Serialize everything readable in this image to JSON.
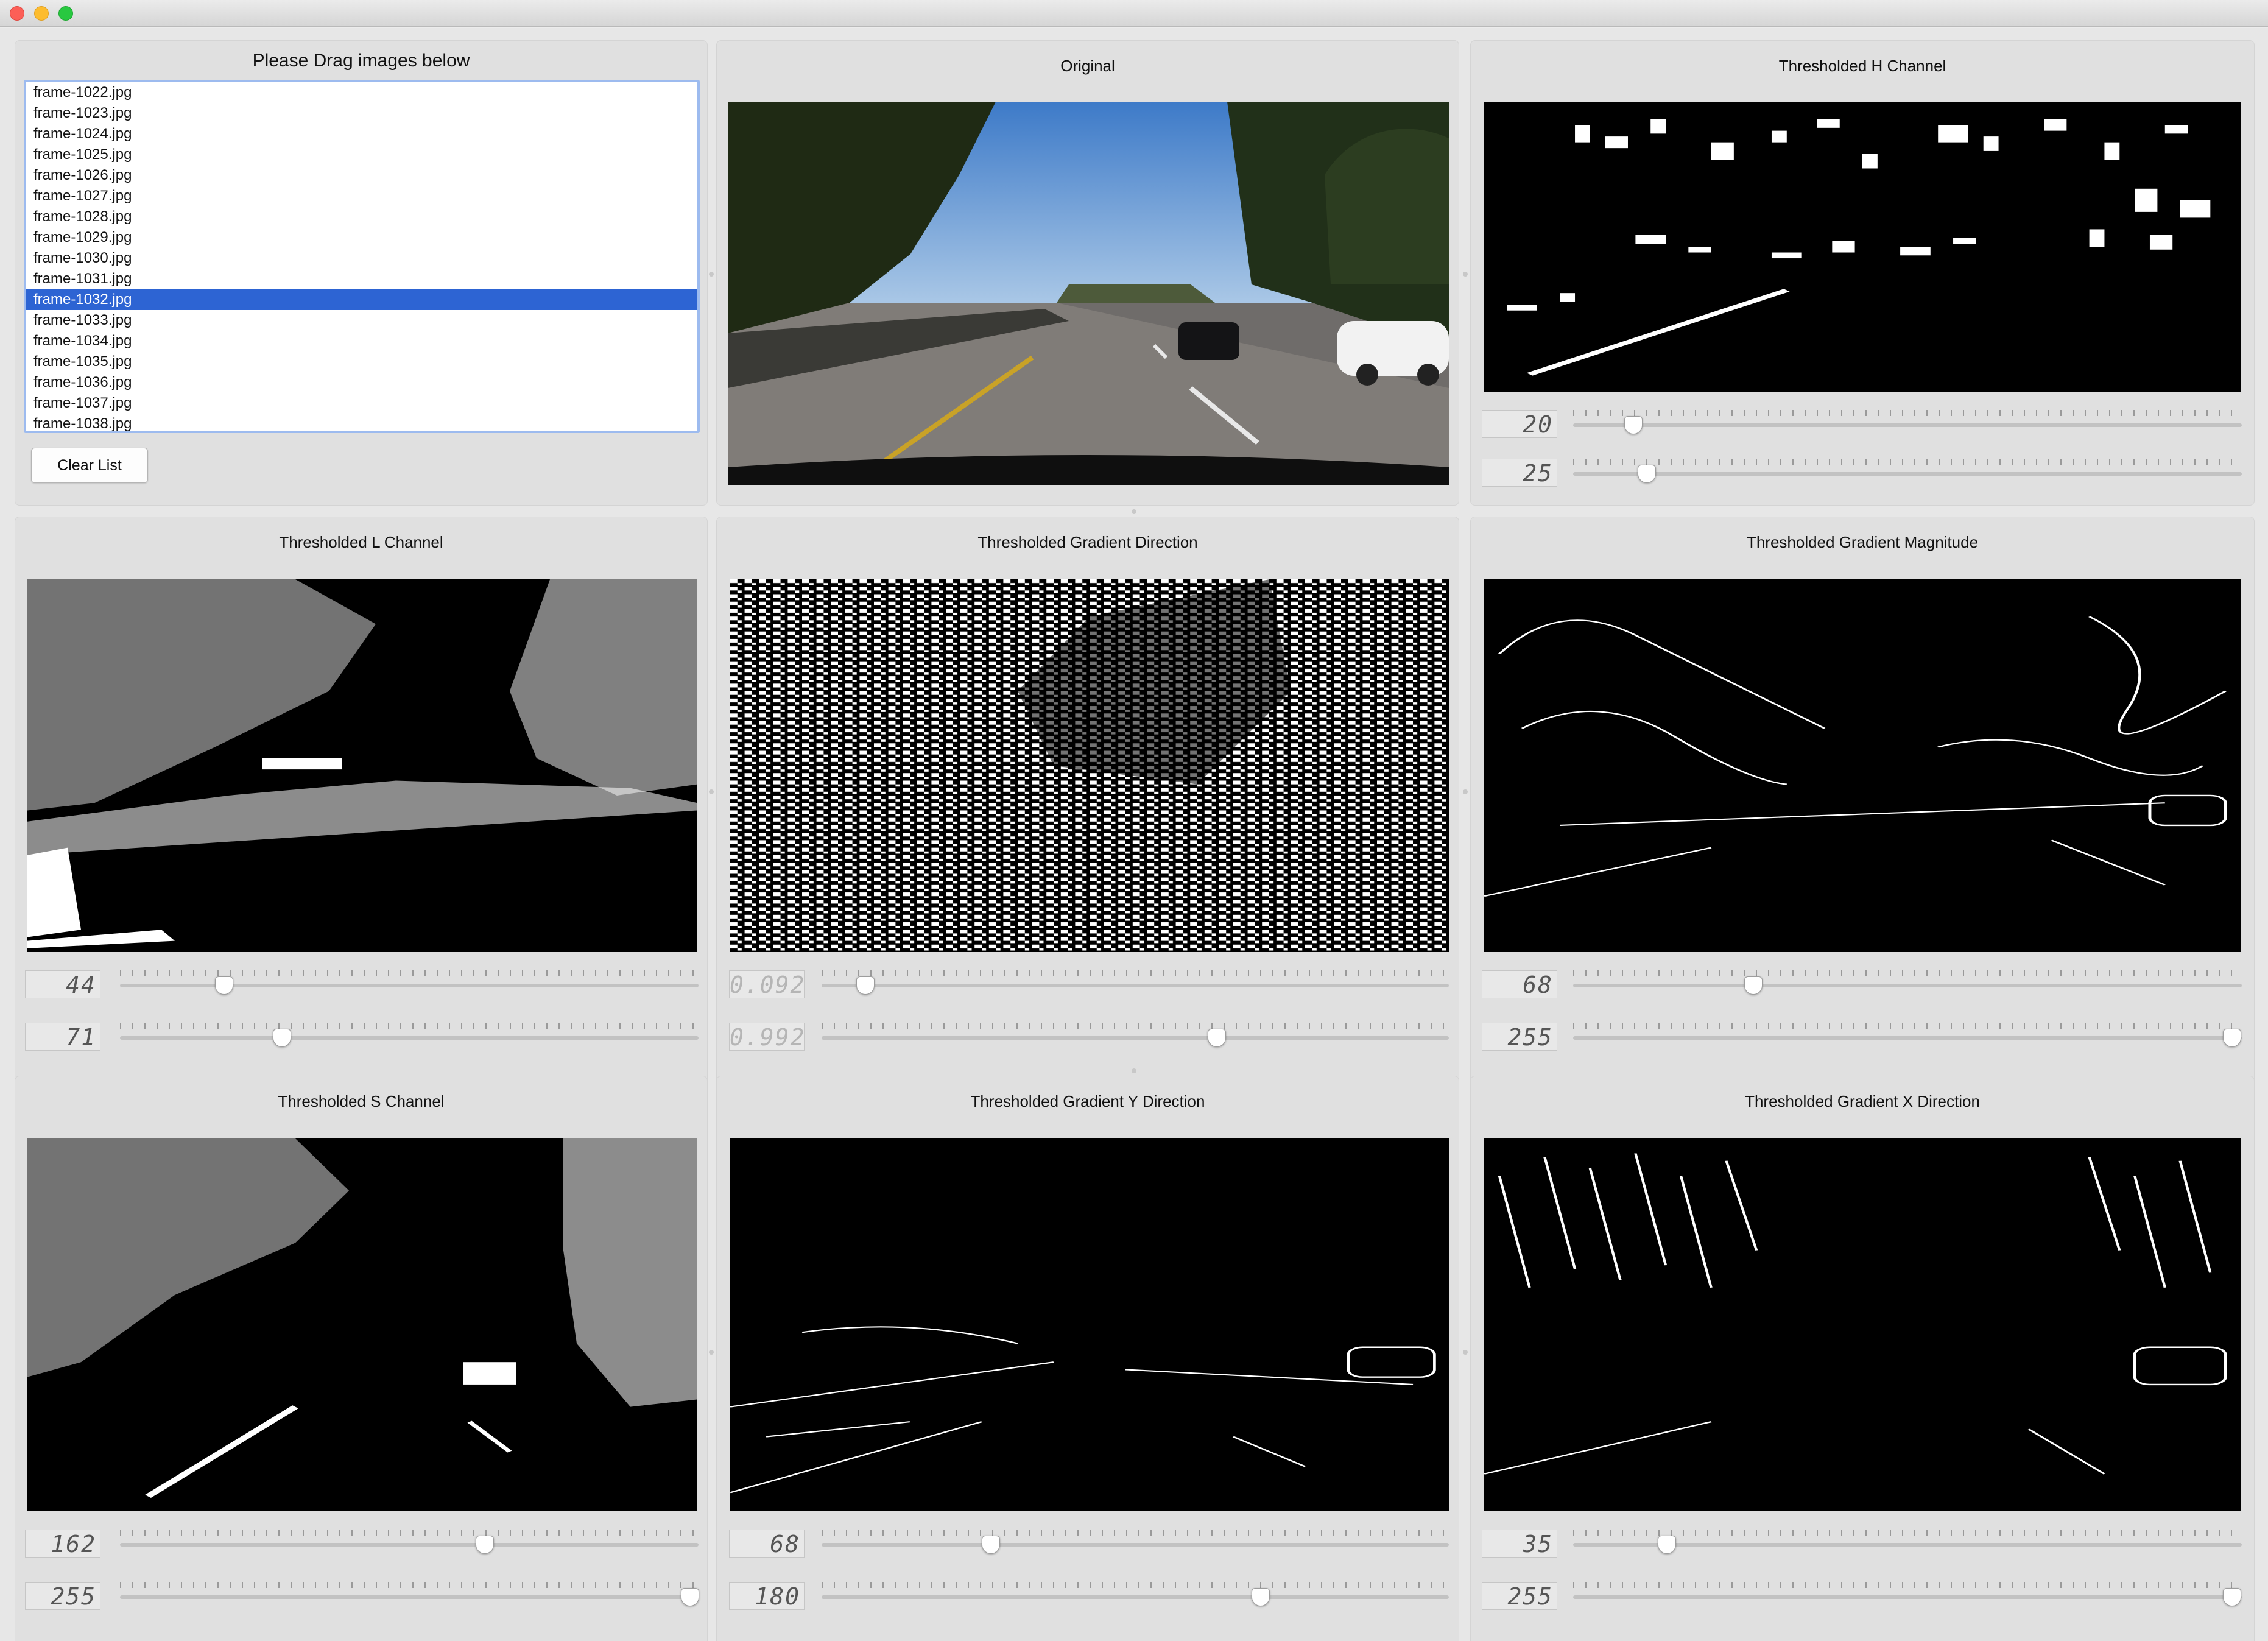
{
  "window": {
    "traffic_lights": [
      "close",
      "minimize",
      "maximize"
    ]
  },
  "file_panel": {
    "title": "Please Drag images below",
    "files": [
      "frame-1022.jpg",
      "frame-1023.jpg",
      "frame-1024.jpg",
      "frame-1025.jpg",
      "frame-1026.jpg",
      "frame-1027.jpg",
      "frame-1028.jpg",
      "frame-1029.jpg",
      "frame-1030.jpg",
      "frame-1031.jpg",
      "frame-1032.jpg",
      "frame-1033.jpg",
      "frame-1034.jpg",
      "frame-1035.jpg",
      "frame-1036.jpg",
      "frame-1037.jpg",
      "frame-1038.jpg"
    ],
    "selected_file": "frame-1032.jpg",
    "clear_button": "Clear List"
  },
  "panels": {
    "original": {
      "title": "Original"
    },
    "h_channel": {
      "title": "Thresholded H Channel",
      "low": {
        "value": "20",
        "fraction": 0.09
      },
      "high": {
        "value": "25",
        "fraction": 0.11
      }
    },
    "l_channel": {
      "title": "Thresholded L Channel",
      "low": {
        "value": "44",
        "fraction": 0.18
      },
      "high": {
        "value": "71",
        "fraction": 0.28
      }
    },
    "gradient_direction": {
      "title": "Thresholded Gradient Direction",
      "low": {
        "value": "0.092",
        "fraction": 0.07
      },
      "high": {
        "value": "0.992",
        "fraction": 0.63
      }
    },
    "gradient_magnitude": {
      "title": "Thresholded Gradient Magnitude",
      "low": {
        "value": "68",
        "fraction": 0.27
      },
      "high": {
        "value": "255",
        "fraction": 1.0
      }
    },
    "s_channel": {
      "title": "Thresholded S Channel",
      "low": {
        "value": "162",
        "fraction": 0.63
      },
      "high": {
        "value": "255",
        "fraction": 1.0
      }
    },
    "gradient_y": {
      "title": "Thresholded Gradient Y Direction",
      "low": {
        "value": "68",
        "fraction": 0.27
      },
      "high": {
        "value": "180",
        "fraction": 0.7
      }
    },
    "gradient_x": {
      "title": "Thresholded Gradient X Direction",
      "low": {
        "value": "35",
        "fraction": 0.14
      },
      "high": {
        "value": "255",
        "fraction": 1.0
      }
    }
  }
}
